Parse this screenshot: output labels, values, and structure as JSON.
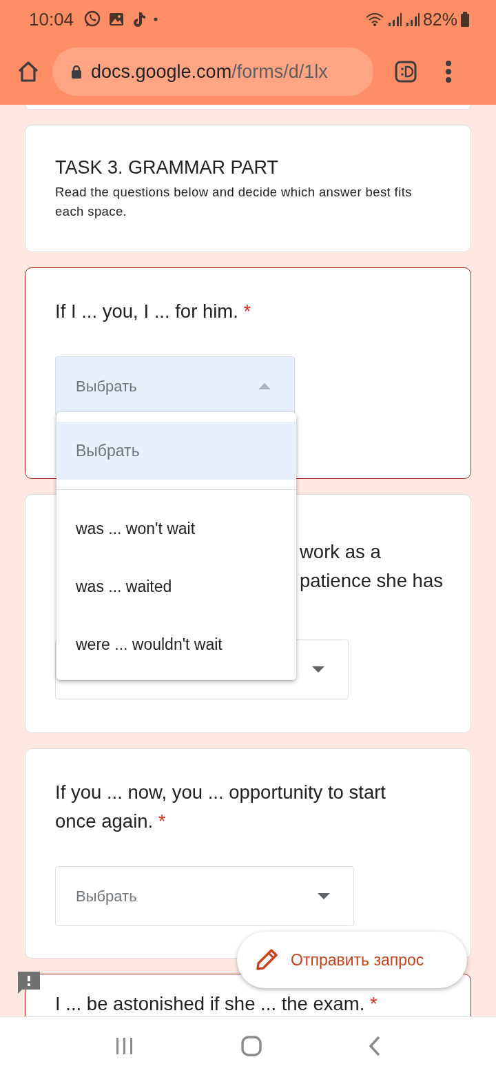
{
  "status_bar": {
    "time": "10:04",
    "battery": "82%"
  },
  "browser": {
    "url_host": "docs.google.com",
    "url_path": "/forms/d/1lx"
  },
  "section": {
    "title": "TASK 3. GRAMMAR PART",
    "description": "Read the questions below and decide which answer best fits each space."
  },
  "questions": [
    {
      "kind": "full",
      "lines": [
        "If I ... you, I ... for him."
      ],
      "required_mark": "*",
      "error": true,
      "dropdown": {
        "value": "Выбрать",
        "expanded": true
      }
    },
    {
      "kind": "partial",
      "lines": [
        "work as a",
        "patience she has"
      ],
      "error": false,
      "dropdown": {
        "expanded": false
      }
    },
    {
      "kind": "full",
      "lines": [
        "If you ... now, you ... opportunity to start",
        "once again."
      ],
      "required_mark": "*",
      "error": false,
      "dropdown": {
        "value": "Выбрать",
        "expanded": false
      }
    },
    {
      "kind": "full",
      "lines": [
        "I ... be astonished if she ... the exam."
      ],
      "required_mark": "*",
      "error": true
    }
  ],
  "dropdown_menu": {
    "options": [
      {
        "label": "Выбрать",
        "selected": true
      },
      {
        "label": "was ... won't wait",
        "selected": false
      },
      {
        "label": "was ... waited",
        "selected": false
      },
      {
        "label": "were ... wouldn't wait",
        "selected": false
      }
    ]
  },
  "fab": {
    "label": "Отправить запрос"
  }
}
